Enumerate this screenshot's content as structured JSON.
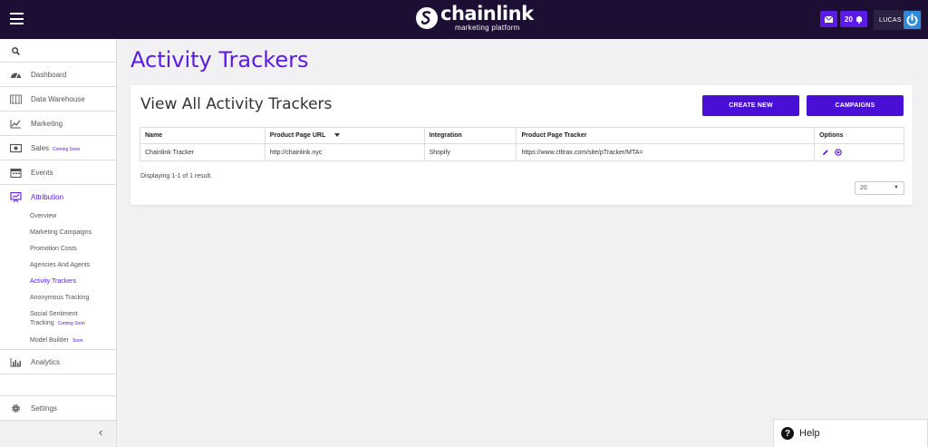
{
  "brand": {
    "name": "chainlink",
    "tagline": "marketing platform"
  },
  "topbar": {
    "notification_count": "20",
    "user": "LUCAS"
  },
  "sidebar": {
    "items": [
      {
        "label": "Dashboard",
        "soon": ""
      },
      {
        "label": "Data Warehouse",
        "soon": ""
      },
      {
        "label": "Marketing",
        "soon": ""
      },
      {
        "label": "Sales",
        "soon": "Coming Soon"
      },
      {
        "label": "Events",
        "soon": ""
      },
      {
        "label": "Attribution",
        "soon": ""
      }
    ],
    "sub_items": [
      {
        "label": "Overview"
      },
      {
        "label": "Marketing Campaigns"
      },
      {
        "label": "Promotion Costs"
      },
      {
        "label": "Agencies And Agents"
      },
      {
        "label": "Activity Trackers"
      },
      {
        "label": "Anonymous Tracking"
      },
      {
        "label": "Social Sentiment",
        "label2": "Tracking",
        "soon": "Coming Soon"
      },
      {
        "label": "Model Builder",
        "soon": "Soon"
      }
    ],
    "analytics": "Analytics",
    "settings": "Settings"
  },
  "page": {
    "title": "Activity Trackers"
  },
  "card": {
    "title": "View All Activity Trackers",
    "create_label": "CREATE NEW",
    "campaigns_label": "CAMPAIGNS",
    "columns": [
      "Name",
      "Product Page URL",
      "Integration",
      "Product Page Tracker",
      "Options"
    ],
    "rows": [
      {
        "name": "Chainlink Tracker",
        "url": "http://chainlink.nyc",
        "integration": "Shopify",
        "tracker": "https://www.ctltrax.com/site/pTracker/MTA="
      }
    ],
    "summary": "Displaying 1-1 of 1 result.",
    "page_size": "20"
  },
  "help": {
    "label": "Help"
  },
  "colors": {
    "accent": "#5a1be6",
    "topbar": "#1c0f33",
    "button": "#4a0fd6"
  }
}
